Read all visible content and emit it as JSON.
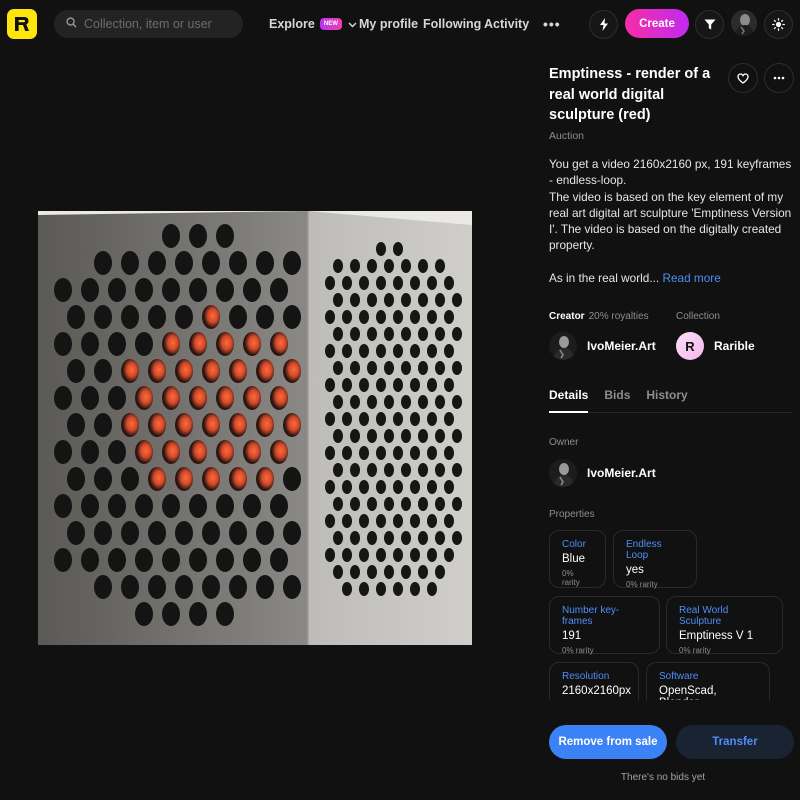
{
  "header": {
    "logo_icon": "rarible-logo-icon",
    "search_placeholder": "Collection, item or user",
    "nav": {
      "explore": "Explore",
      "new_badge": "NEW",
      "my_profile": "My profile",
      "following": "Following",
      "activity": "Activity",
      "more": "•••"
    },
    "create_label": "Create",
    "accent_gradient": [
      "#f72ca6",
      "#c02bf1"
    ]
  },
  "item": {
    "title": "Emptiness - render of a real world digital sculpture (red)",
    "sale_type": "Auction",
    "description": [
      "You get a video 2160x2160 px, 191 keyframes - endless-loop.",
      "The video is based on the key element of my real art digital art sculpture 'Emptiness Version I'. The video is based on the digitally created property.",
      "",
      "As in the real world..."
    ],
    "read_more": "Read more",
    "creator_label": "Creator",
    "royalties": "20% royalties",
    "creator_name": "IvoMeier.Art",
    "collection_label": "Collection",
    "collection_name": "Rarible",
    "collection_initial": "R"
  },
  "tabs": [
    {
      "label": "Details",
      "active": true
    },
    {
      "label": "Bids",
      "active": false
    },
    {
      "label": "History",
      "active": false
    }
  ],
  "details": {
    "owner_label": "Owner",
    "owner_name": "IvoMeier.Art",
    "properties_label": "Properties",
    "properties": [
      {
        "type": "Color",
        "value": "Blue",
        "rarity": "0% rarity"
      },
      {
        "type": "Endless Loop",
        "value": "yes",
        "rarity": "0% rarity"
      },
      {
        "type": "Number key-frames",
        "value": "191",
        "rarity": "0% rarity"
      },
      {
        "type": "Real World Sculpture",
        "value": "Emptiness V 1",
        "rarity": "0% rarity"
      },
      {
        "type": "Resolution",
        "value": "2160x2160px",
        "rarity": ""
      },
      {
        "type": "Software",
        "value": "OpenScad, Blender",
        "rarity": ""
      }
    ]
  },
  "actions": {
    "remove_label": "Remove from sale",
    "transfer_label": "Transfer",
    "no_bids": "There's no bids yet"
  },
  "colors": {
    "background": "#111111",
    "link_blue": "#4f8df7",
    "primary_button": "#3b82f6",
    "logo_yellow": "#fee60d"
  }
}
